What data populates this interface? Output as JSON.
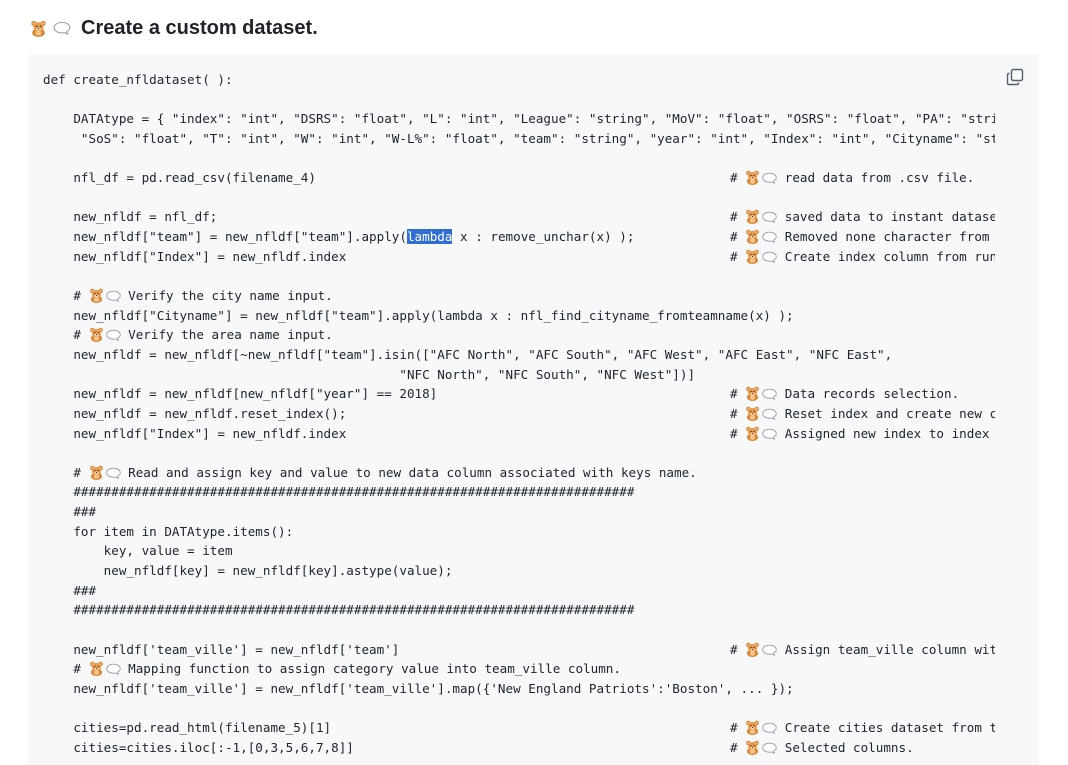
{
  "heading": {
    "title": "Create a custom dataset."
  },
  "code_lines": [
    {
      "code": "def create_nfldataset( ):"
    },
    {
      "code": ""
    },
    {
      "code": "    DATAtype = { \"index\": \"int\", \"DSRS\": \"float\", \"L\": \"int\", \"League\": \"string\", \"MoV\": \"float\", \"OSRS\": \"float\", \"PA\": \"string"
    },
    {
      "code": "     \"SoS\": \"float\", \"T\": \"int\", \"W\": \"int\", \"W-L%\": \"float\", \"team\": \"string\", \"year\": \"int\", \"Index\": \"int\", \"Cityname\": \"str"
    },
    {
      "code": ""
    },
    {
      "code": "    nfl_df = pd.read_csv(filename_4)",
      "comment": "read data from .csv file."
    },
    {
      "code": ""
    },
    {
      "code": "    new_nfldf = nfl_df;",
      "comment": "saved data to instant dataset"
    },
    {
      "code_pre": "    new_nfldf[\"team\"] = new_nfldf[\"team\"].apply(",
      "code_hl": "lambda",
      "code_post": " x : remove_unchar(x) );",
      "comment": "Removed none character from th"
    },
    {
      "code": "    new_nfldf[\"Index\"] = new_nfldf.index",
      "comment": "Create index column from runni"
    },
    {
      "code": ""
    },
    {
      "code": "    #",
      "inline_comment": "Verify the city name input."
    },
    {
      "code": "    new_nfldf[\"Cityname\"] = new_nfldf[\"team\"].apply(lambda x : nfl_find_cityname_fromteamname(x) );"
    },
    {
      "code": "    #",
      "inline_comment": "Verify the area name input."
    },
    {
      "code": "    new_nfldf = new_nfldf[~new_nfldf[\"team\"].isin([\"AFC North\", \"AFC South\", \"AFC West\", \"AFC East\", \"NFC East\","
    },
    {
      "code": "                                               \"NFC North\", \"NFC South\", \"NFC West\"])]"
    },
    {
      "code": "    new_nfldf = new_nfldf[new_nfldf[\"year\"] == 2018]",
      "comment": "Data records selection."
    },
    {
      "code": "    new_nfldf = new_nfldf.reset_index();",
      "comment": "Reset index and create new col"
    },
    {
      "code": "    new_nfldf[\"Index\"] = new_nfldf.index",
      "comment": "Assigned new index to index co"
    },
    {
      "code": ""
    },
    {
      "code": "    #",
      "inline_comment": "Read and assign key and value to new data column associated with keys name."
    },
    {
      "code": "    ##########################################################################"
    },
    {
      "code": "    ###"
    },
    {
      "code": "    for item in DATAtype.items():"
    },
    {
      "code": "        key, value = item"
    },
    {
      "code": "        new_nfldf[key] = new_nfldf[key].astype(value);"
    },
    {
      "code": "    ###"
    },
    {
      "code": "    ##########################################################################"
    },
    {
      "code": ""
    },
    {
      "code": "    new_nfldf['team_ville'] = new_nfldf['team']",
      "comment": "Assign team_ville column with"
    },
    {
      "code": "    #",
      "inline_comment": "Mapping function to assign category value into team_ville column."
    },
    {
      "code": "    new_nfldf['team_ville'] = new_nfldf['team_ville'].map({'New England Patriots':'Boston', ... });"
    },
    {
      "code": ""
    },
    {
      "code": "    cities=pd.read_html(filename_5)[1]",
      "comment": "Create cities dataset from tab"
    },
    {
      "code": "    cities=cities.iloc[:-1,[0,3,5,6,7,8]]",
      "comment": "Selected columns."
    }
  ],
  "icons": {
    "bear": "teddy-bear-icon",
    "bubble": "speech-bubble-icon",
    "copy": "copy-icon"
  },
  "colors": {
    "code_background": "#f6f8fa",
    "selection": "#2f6fd3",
    "text": "#1f2328"
  }
}
